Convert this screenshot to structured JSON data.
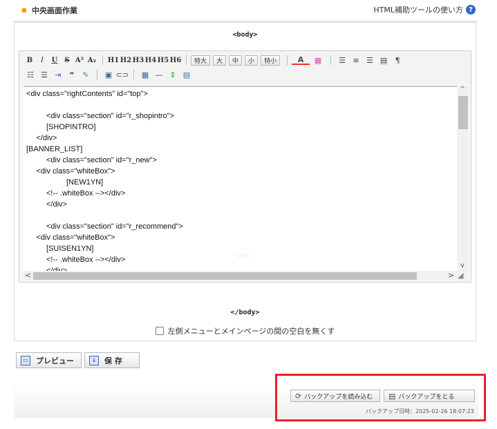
{
  "header": {
    "title": "中央画面作業",
    "help_link": "HTML補助ツールの使い方",
    "help_icon": "?"
  },
  "panel": {
    "body_open": "<body>",
    "body_close": "</body>"
  },
  "toolbar": {
    "row1": {
      "format_buttons": [
        "B",
        "I",
        "U",
        "S",
        "A²",
        "A₂"
      ],
      "heading_buttons": [
        "H1",
        "H2",
        "H3",
        "H4",
        "H5",
        "H6"
      ],
      "size_buttons": [
        "特大",
        "大",
        "中",
        "小",
        "特小"
      ],
      "font_color_icon": "A",
      "bg_color_icon": "▦",
      "align_icons": [
        "align-left-icon",
        "align-center-icon",
        "align-right-icon",
        "align-justify-icon",
        "pilcrow-icon"
      ]
    },
    "row2": {
      "icons": [
        "bullet-list-icon",
        "numbered-list-icon",
        "indent-icon",
        "quote-icon",
        "remove-format-icon",
        "image-icon",
        "link-icon",
        "table-icon",
        "horizontal-rule-icon",
        "spacer-icon",
        "file-icon"
      ]
    }
  },
  "editor": {
    "lines": [
      {
        "text": "<div class=\"rightContents\" id=\"top\">",
        "indent": 0
      },
      {
        "text": "",
        "indent": 0
      },
      {
        "text": "<div class=\"section\" id=\"r_shopintro\">",
        "indent": 2
      },
      {
        "text": "[SHOPINTRO]",
        "indent": 2
      },
      {
        "text": "</div>",
        "indent": 1
      },
      {
        "text": "[BANNER_LIST]",
        "indent": 0
      },
      {
        "text": "<div class=\"section\" id=\"r_new\">",
        "indent": 2
      },
      {
        "text": "<div class=\"whiteBox\">",
        "indent": 1
      },
      {
        "text": "[NEW1YN]",
        "indent": 4
      },
      {
        "text": "<!-- .whiteBox --></div>",
        "indent": 2
      },
      {
        "text": "</div>",
        "indent": 2
      },
      {
        "text": "",
        "indent": 0
      },
      {
        "text": "<div class=\"section\" id=\"r_recommend\">",
        "indent": 2
      },
      {
        "text": "<div class=\"whiteBox\">",
        "indent": 1
      },
      {
        "text": "[SUISEN1YN]",
        "indent": 2
      },
      {
        "text": "<!-- .whiteBox --></div>",
        "indent": 2
      },
      {
        "text": "</div>",
        "indent": 2
      }
    ],
    "vscroll_up": "^",
    "vscroll_down": "v",
    "hscroll_left": "<",
    "hscroll_right": ">",
    "resize_handle": "·:·:·:"
  },
  "options": {
    "remove_spacing_label": "左側メニューとメインページの間の空白を無くす",
    "remove_spacing_checked": false
  },
  "actions": {
    "preview_label": "プレビュー",
    "save_label": "保 存"
  },
  "backup": {
    "load_label": "バックアップを読み込む",
    "create_label": "バックアップをとる",
    "date_text": "バックアップ日時：2025-02-26 18:07:23"
  }
}
